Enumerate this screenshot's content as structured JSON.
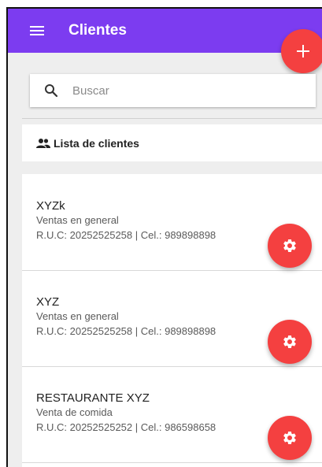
{
  "appbar": {
    "title": "Clientes",
    "menu_icon": "menu-icon",
    "add_icon": "plus-icon"
  },
  "search": {
    "placeholder": "Buscar",
    "value": "",
    "icon": "search-icon"
  },
  "list_header": {
    "icon": "people-icon",
    "label": "Lista de clientes"
  },
  "clients": [
    {
      "name": "XYZk",
      "category": "Ventas en general",
      "details": "R.U.C: 20252525258 | Cel.: 989898898",
      "action_icon": "gear-icon"
    },
    {
      "name": "XYZ",
      "category": "Ventas en general",
      "details": "R.U.C: 20252525258 | Cel.: 989898898",
      "action_icon": "gear-icon"
    },
    {
      "name": "RESTAURANTE XYZ",
      "category": "Venta de comida",
      "details": "R.U.C: 20252525252 | Cel.: 986598658",
      "action_icon": "gear-icon"
    }
  ],
  "colors": {
    "primary": "#7c3cf0",
    "accent": "#f44040",
    "background": "#eeeeee"
  }
}
